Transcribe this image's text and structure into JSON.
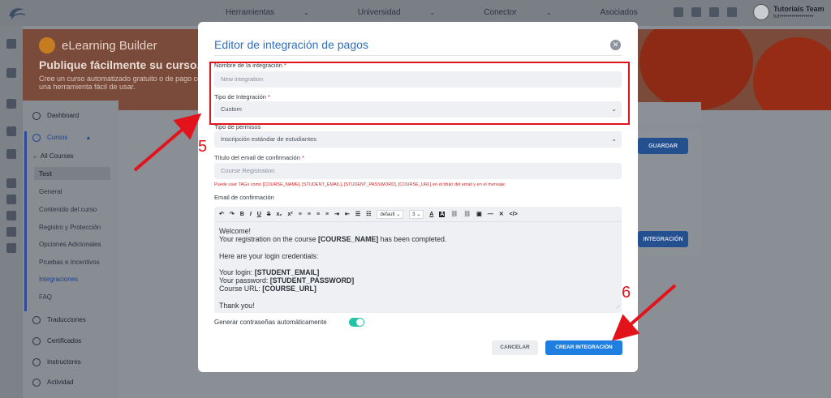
{
  "topbar": {
    "nav": [
      "Herramientas",
      "Universidad",
      "Conector",
      "Asociados"
    ],
    "user_name": "Tutorials Team",
    "user_sub": "tut•••••••••••••••••"
  },
  "hero": {
    "title": "eLearning Builder",
    "subtitle": "Publique fácilmente su curso.",
    "description": "Cree un curso automatizado gratuito o de pago con una herramienta fácil de usar."
  },
  "sidebar": {
    "dashboard": "Dashboard",
    "cursos": "Cursos",
    "all_courses": "All Courses",
    "test": "Test",
    "items": [
      "General",
      "Contenido del curso",
      "Registro y Protección",
      "Opciones Adicionales",
      "Pruebas e Incentivos",
      "Integraciones",
      "FAQ"
    ],
    "traducciones": "Traducciones",
    "certificados": "Certificados",
    "instructores": "Instructores",
    "actividad": "Actividad"
  },
  "background": {
    "guardar": "GUARDAR",
    "integracion": "INTEGRACIÓN"
  },
  "modal": {
    "title": "Editor de integración de pagos",
    "name_label": "Nombre de la integración",
    "name_placeholder": "New integration",
    "type_label": "Tipo de Integración",
    "type_value": "Custom",
    "perm_label": "Tipo de permisos",
    "perm_value": "Inscripción estándar de estudiantes",
    "email_title_label": "Título del email de confirmación",
    "email_title_placeholder": "Course Registration",
    "warning": "Puede usar TAGs como [COURSE_NAME], [STUDENT_EMAIL], [STUDENT_PASSWORD], [COURSE_URL] en el título del email y en el mensaje.",
    "email_label": "Email de confirmación",
    "toolbar": {
      "font": "default",
      "size": "3"
    },
    "email_body": {
      "welcome": "Welcome!",
      "line1_pre": "Your registration on the course ",
      "line1_tag": "[COURSE_NAME]",
      "line1_post": " has been completed.",
      "line2": "Here are your login credentials:",
      "login_pre": "Your login: ",
      "login_tag": "[STUDENT_EMAIL]",
      "pass_pre": "Your password: ",
      "pass_tag": "[STUDENT_PASSWORD]",
      "url_pre": "Course URL: ",
      "url_tag": "[COURSE_URL]",
      "thanks": "Thank you!"
    },
    "toggle_label": "Generar contraseñas automáticamente",
    "cancel": "CANCELAR",
    "create": "CREAR INTEGRACIÓN"
  },
  "annotations": {
    "step5": "5",
    "step6": "6",
    "color": "#e3131b"
  }
}
